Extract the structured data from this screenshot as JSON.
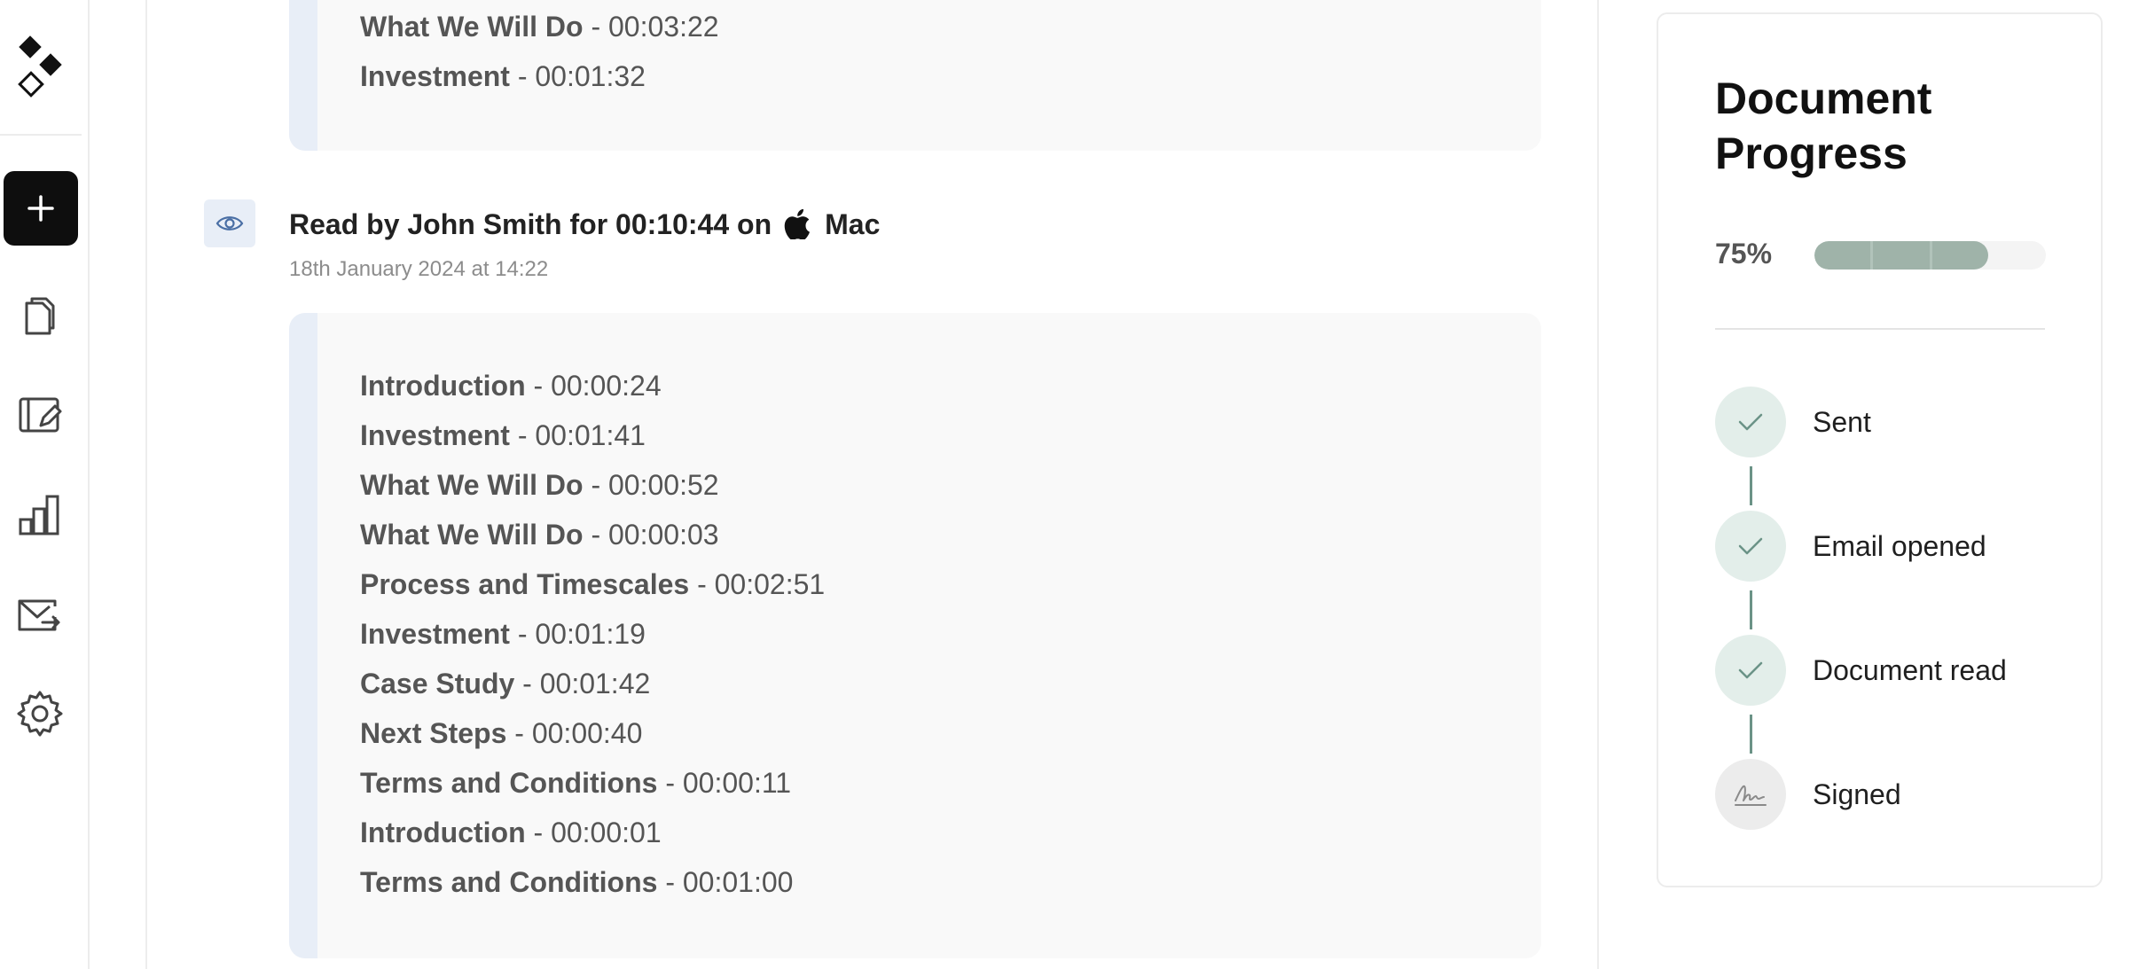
{
  "sidebar": {
    "new_button_icon": "plus-icon",
    "nav": [
      {
        "name": "documents",
        "icon": "documents-icon"
      },
      {
        "name": "templates",
        "icon": "edit-panel-icon"
      },
      {
        "name": "analytics",
        "icon": "bar-chart-icon"
      },
      {
        "name": "outbox",
        "icon": "mail-send-icon"
      },
      {
        "name": "settings",
        "icon": "gear-icon"
      }
    ]
  },
  "previous_session": {
    "sections": [
      {
        "name": "What We Will Do",
        "time": "- 00:03:22"
      },
      {
        "name": "Investment",
        "time": "- 00:01:32"
      }
    ]
  },
  "reading_session": {
    "heading": "Read by John Smith for 00:10:44 on",
    "device": "Mac",
    "date": "18th January 2024 at 14:22",
    "sections": [
      {
        "name": "Introduction",
        "time": "- 00:00:24"
      },
      {
        "name": "Investment",
        "time": "- 00:01:41"
      },
      {
        "name": "What We Will Do",
        "time": "- 00:00:52"
      },
      {
        "name": "What We Will Do",
        "time": "- 00:00:03"
      },
      {
        "name": "Process and Timescales",
        "time": "- 00:02:51"
      },
      {
        "name": "Investment",
        "time": "- 00:01:19"
      },
      {
        "name": "Case Study",
        "time": "- 00:01:42"
      },
      {
        "name": "Next Steps",
        "time": "- 00:00:40"
      },
      {
        "name": "Terms and Conditions",
        "time": "- 00:00:11"
      },
      {
        "name": "Introduction",
        "time": "- 00:00:01"
      },
      {
        "name": "Terms and Conditions",
        "time": "- 00:01:00"
      }
    ]
  },
  "progress_panel": {
    "title": "Document Progress",
    "percent_label": "75%",
    "percent_value": 0.75,
    "accent_color": "#6b9387",
    "steps": [
      {
        "label": "Sent",
        "status": "complete",
        "icon": "check-icon"
      },
      {
        "label": "Email opened",
        "status": "complete",
        "icon": "check-icon"
      },
      {
        "label": "Document read",
        "status": "complete",
        "icon": "check-icon"
      },
      {
        "label": "Signed",
        "status": "pending",
        "icon": "signature-icon"
      }
    ]
  }
}
